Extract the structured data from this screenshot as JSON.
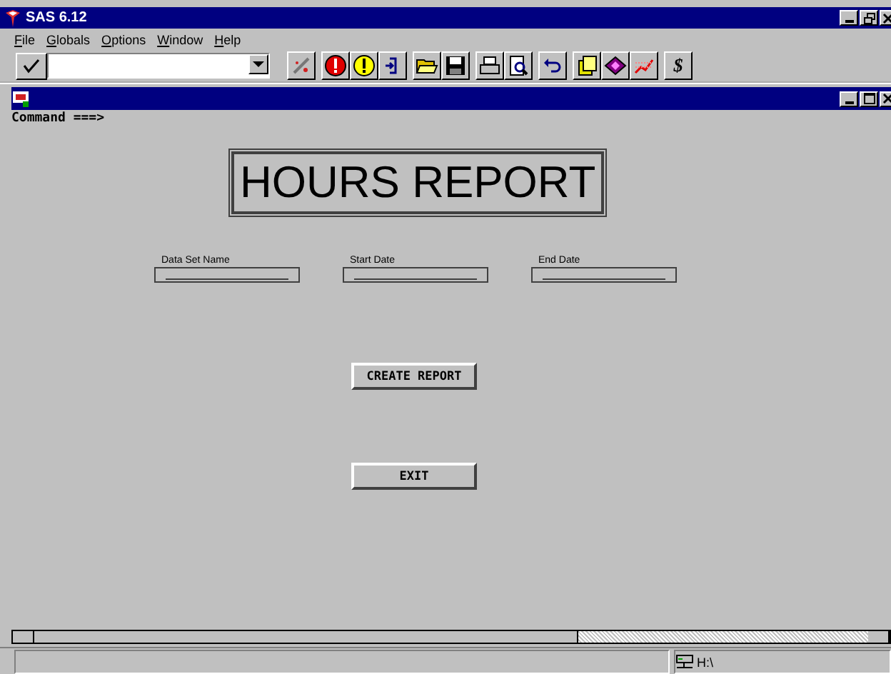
{
  "window": {
    "title": "SAS 6.12"
  },
  "menu": [
    "File",
    "Globals",
    "Options",
    "Window",
    "Help"
  ],
  "command": {
    "label": "Command ===>"
  },
  "report": {
    "title": "HOURS REPORT",
    "fields": [
      {
        "label": "Data Set Name"
      },
      {
        "label": "Start Date"
      },
      {
        "label": "End Date"
      }
    ],
    "buttons": [
      "CREATE REPORT",
      "EXIT"
    ]
  },
  "toolbar": {
    "dollar": "$"
  },
  "status_bar": {
    "drive": "H:\\"
  }
}
